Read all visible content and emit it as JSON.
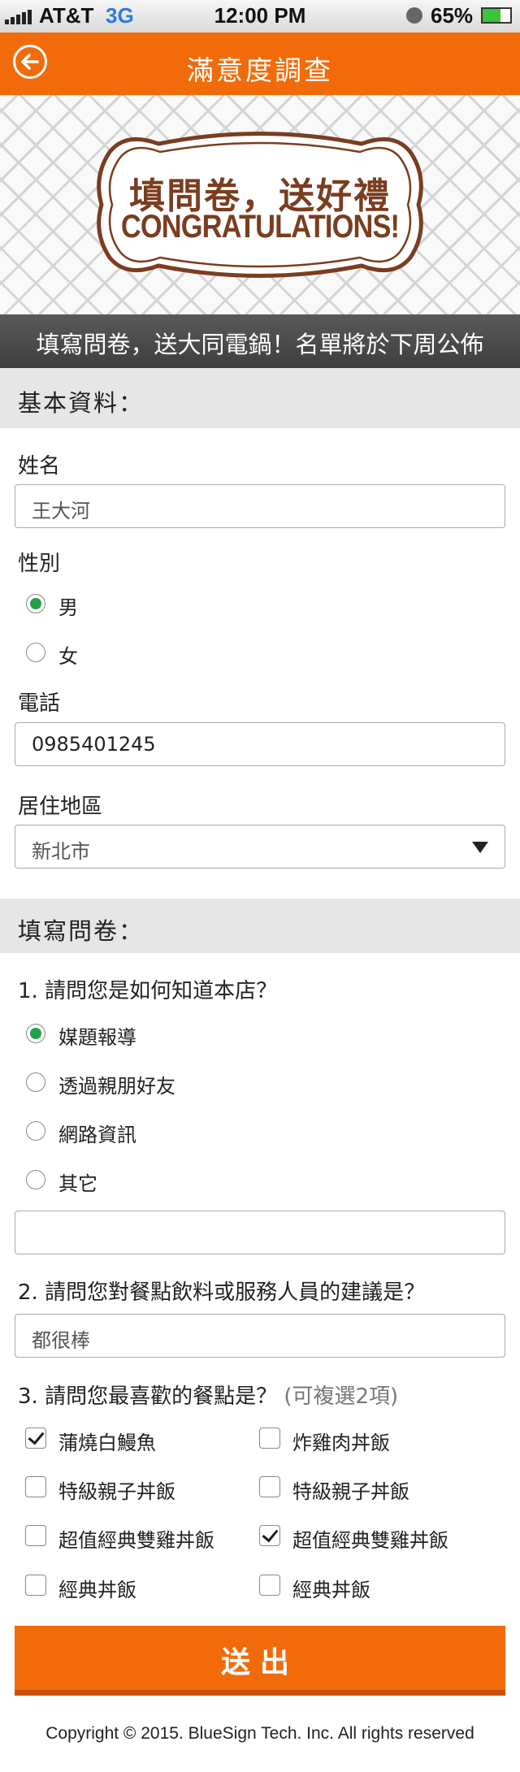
{
  "status_bar": {
    "carrier": "AT&T",
    "network": "3G",
    "time": "12:00 PM",
    "battery": "65%"
  },
  "nav": {
    "title": "滿意度調查",
    "back_icon": "back-arrow-icon"
  },
  "banner": {
    "line1": "填問卷，送好禮",
    "line2": "CONGRATULATIONS!"
  },
  "promo": {
    "text": "填寫問卷，送大同電鍋！名單將於下周公佈"
  },
  "basic": {
    "section_title": "基本資料：",
    "name_label": "姓名",
    "name_placeholder": "王大河",
    "gender_label": "性別",
    "gender_options": [
      "男",
      "女"
    ],
    "gender_selected": "男",
    "phone_label": "電話",
    "phone_value": "0985401245",
    "region_label": "居住地區",
    "region_value": "新北市"
  },
  "survey": {
    "section_title": "填寫問卷：",
    "q1": {
      "question": "1. 請問您是如何知道本店？",
      "options": [
        "媒題報導",
        "透過親朋好友",
        "網路資訊",
        "其它"
      ],
      "selected": "媒題報導",
      "other_value": ""
    },
    "q2": {
      "question": "2. 請問您對餐點飲料或服務人員的建議是？",
      "placeholder": "都很棒"
    },
    "q3": {
      "question": "3. 請問您最喜歡的餐點是？",
      "hint": "(可複選2項)",
      "left": [
        {
          "label": "蒲燒白鰻魚",
          "checked": true
        },
        {
          "label": "特級親子丼飯",
          "checked": false
        },
        {
          "label": "超值經典雙雞丼飯",
          "checked": false
        },
        {
          "label": "經典丼飯",
          "checked": false
        }
      ],
      "right": [
        {
          "label": "炸雞肉丼飯",
          "checked": false
        },
        {
          "label": "特級親子丼飯",
          "checked": false
        },
        {
          "label": "超值經典雙雞丼飯",
          "checked": true
        },
        {
          "label": "經典丼飯",
          "checked": false
        }
      ]
    }
  },
  "submit_label": "送出",
  "footer": "Copyright © 2015. BlueSign Tech. Inc. All rights reserved",
  "colors": {
    "accent": "#f26b0b",
    "radio_on": "#22a04a",
    "banner_brown": "#7a3d1f"
  }
}
